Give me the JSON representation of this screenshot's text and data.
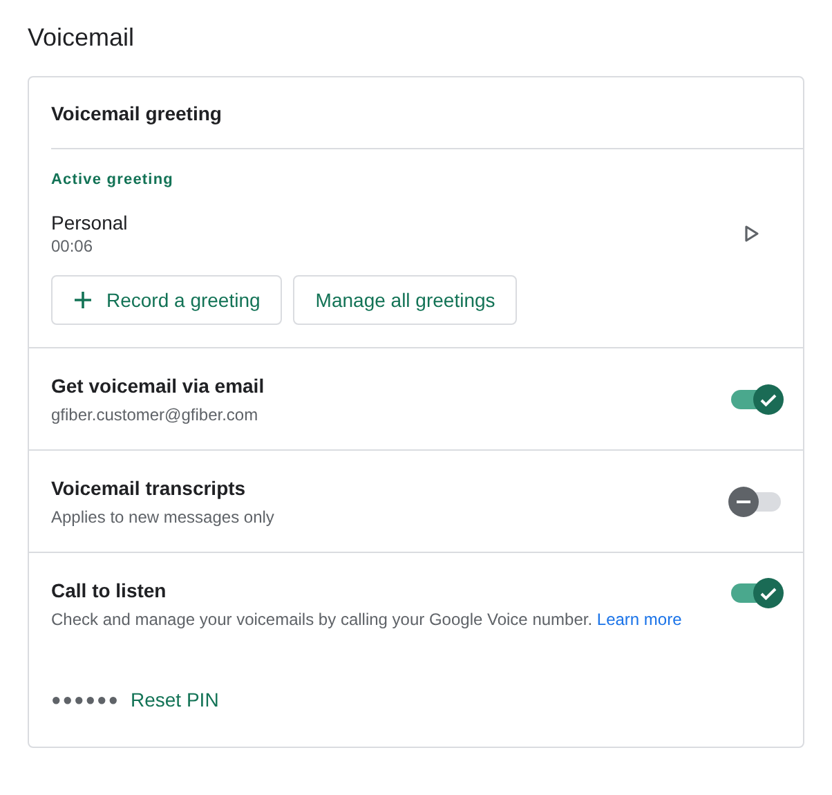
{
  "page_title": "Voicemail",
  "greeting_card": {
    "title": "Voicemail greeting",
    "section_label": "Active greeting",
    "greeting": {
      "name": "Personal",
      "duration": "00:06"
    },
    "buttons": [
      {
        "label": "Record a greeting",
        "kind": "add"
      },
      {
        "label": "Manage all greetings",
        "kind": "plain"
      }
    ]
  },
  "settings": [
    {
      "title": "Get voicemail via email",
      "description": "gfiber.customer@gfiber.com",
      "on": true
    },
    {
      "title": "Voicemail transcripts",
      "description": "Applies to new messages only",
      "on": false
    },
    {
      "title": "Call to listen",
      "description": "Check and manage your voicemails by calling your Google Voice number.",
      "link": "Learn more",
      "on": true,
      "pin": {
        "mask": "●●●●●●",
        "action": "Reset PIN"
      }
    }
  ]
}
